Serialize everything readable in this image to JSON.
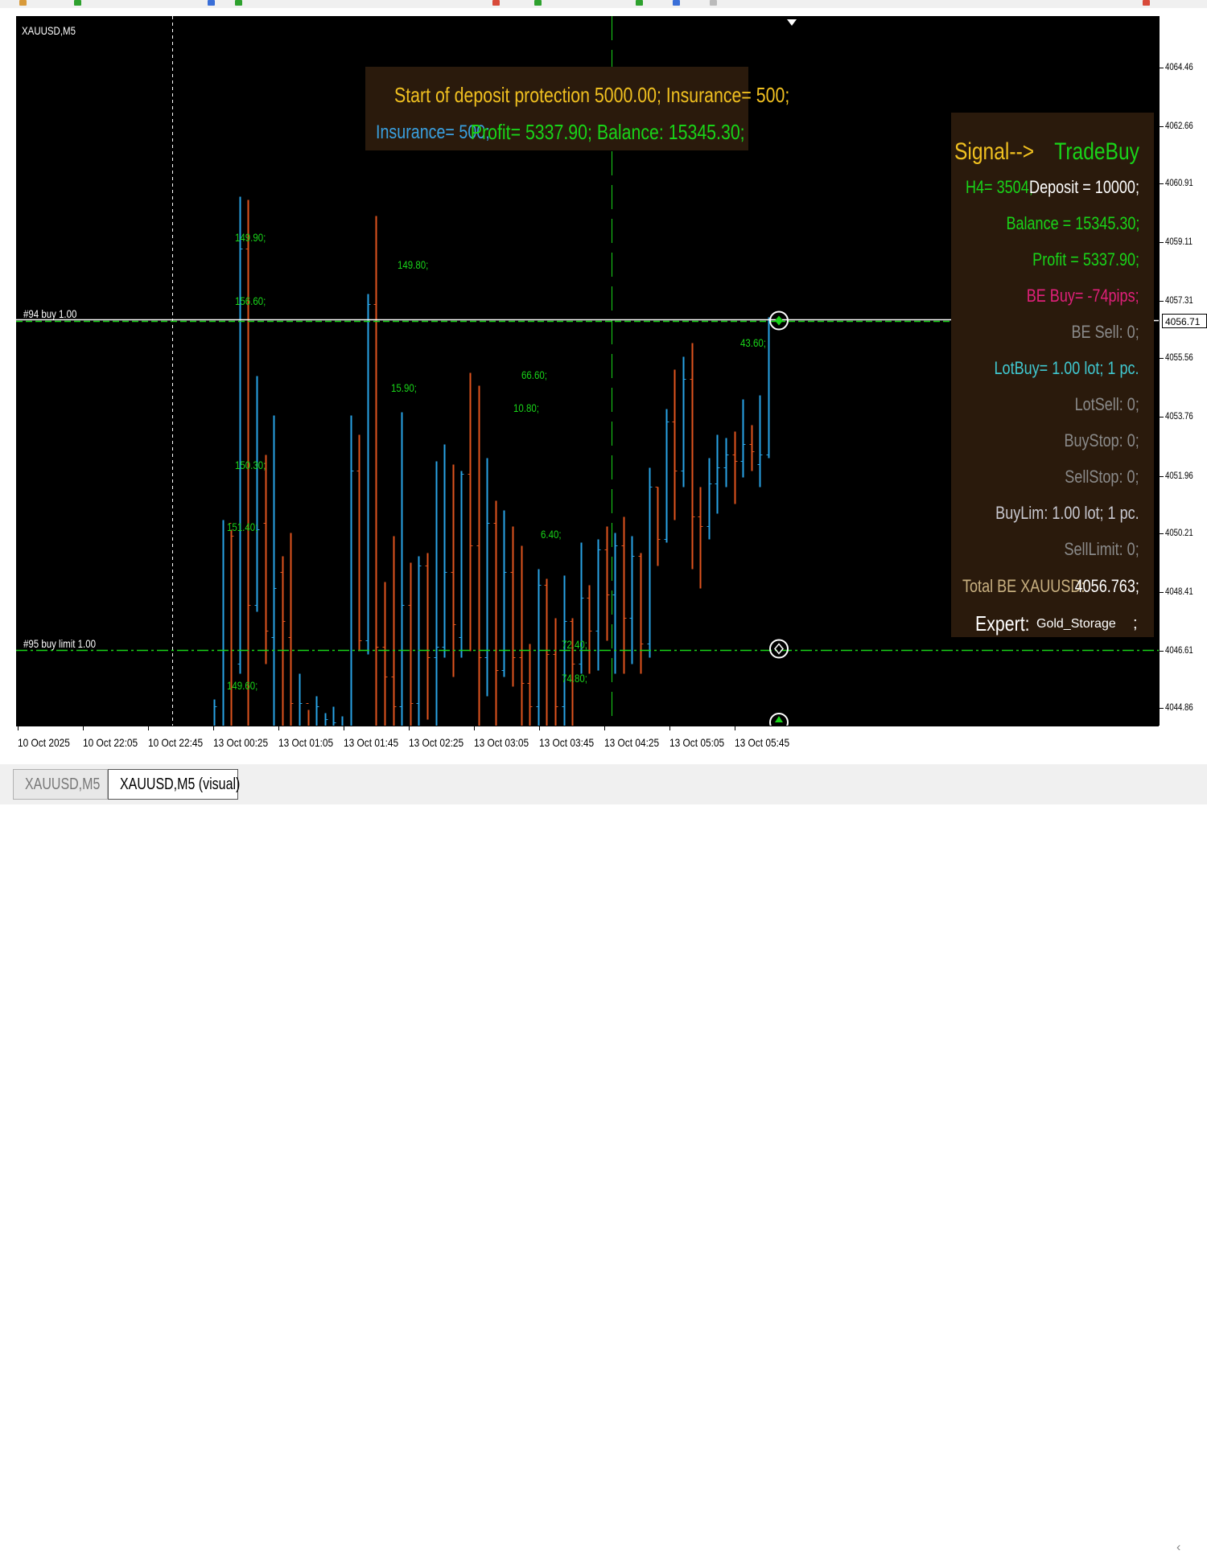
{
  "window": {
    "chart_symbol": "XAUUSD,M5"
  },
  "tabs": [
    {
      "label": "XAUUSD,M5",
      "active": false
    },
    {
      "label": "XAUUSD,M5 (visual)",
      "active": true
    }
  ],
  "colors": {
    "chart_bg": "#000000",
    "bull_candle": "#29a3e6",
    "bear_candle": "#e0541e",
    "green_text": "#19d419",
    "panel_bg": "#2a1a0c",
    "yellow_text": "#f0c020",
    "blue_text": "#3aa0e0",
    "pink_text": "#e0207a",
    "gray_text": "#8a8a8a",
    "cyan_text": "#40c8d0",
    "tan_text": "#c8b080"
  },
  "trades": {
    "buy": "#94 buy 1.00",
    "buy_limit": "#95 buy limit 1.00"
  },
  "top_panel": {
    "line1": "Start of deposit protection 5000.00; Insurance= 500;",
    "insurance": "Insurance= 500;",
    "profit_balance": "Profit= 5337.90; Balance: 15345.30;"
  },
  "right_panel": {
    "signal_label": "Signal-->",
    "signal_value": "TradeBuy",
    "h4": "H4= 3504;",
    "deposit": "Deposit = 10000;",
    "balance": "Balance = 15345.30;",
    "profit": "Profit = 5337.90;",
    "be_buy": "BE Buy= -74pips;",
    "be_sell": "BE Sell: 0;",
    "lot_buy": "LotBuy= 1.00 lot; 1 pc.",
    "lot_sell": "LotSell: 0;",
    "buy_stop": "BuyStop: 0;",
    "sell_stop": "SellStop: 0;",
    "buy_lim": "BuyLim: 1.00 lot; 1 pc.",
    "sell_limit": "SellLimit: 0;",
    "total_be_label": "Total BE XAUUSD:",
    "total_be_value": "4056.763;",
    "expert_label": "Expert:",
    "expert_value": "Gold_Storage",
    "expert_suffix": ";"
  },
  "pl_labels": [
    "149.90;",
    "156.60;",
    "150.30;",
    "151.40;",
    "149.60;",
    "149.80;",
    "15.90;",
    "66.60;",
    "10.80;",
    "6.40;",
    "72.40;",
    "74.80;",
    "43.60;"
  ],
  "price_axis": {
    "labels": [
      "4064.46",
      "4062.66",
      "4060.91",
      "4059.11",
      "4057.31",
      "4055.56",
      "4053.76",
      "4051.96",
      "4050.21",
      "4048.41",
      "4046.61",
      "4044.86"
    ],
    "current": "4056.71"
  },
  "time_axis": {
    "labels": [
      "10 Oct 2025",
      "10 Oct 22:05",
      "10 Oct 22:45",
      "13 Oct 00:25",
      "13 Oct 01:05",
      "13 Oct 01:45",
      "13 Oct 02:25",
      "13 Oct 03:05",
      "13 Oct 03:45",
      "13 Oct 04:25",
      "13 Oct 05:05",
      "13 Oct 05:45"
    ]
  },
  "chart_data": {
    "type": "candlestick",
    "title": "XAUUSD,M5",
    "xlabel": "",
    "ylabel": "",
    "ylim": [
      4044.3,
      4066.0
    ],
    "levels": [
      {
        "name": "#94 buy 1.00",
        "price": 4056.71
      },
      {
        "name": "#95 buy limit 1.00",
        "price": 4046.61
      }
    ],
    "candles": [
      {
        "o": 4044.3,
        "c": 4044.9,
        "h": 4045.1,
        "l": 4044.3
      },
      {
        "o": 4044.3,
        "c": 4044.3,
        "h": 4050.6,
        "l": 4044.3
      },
      {
        "o": 4050.5,
        "c": 4050.1,
        "h": 4050.3,
        "l": 4044.3
      },
      {
        "o": 4046.2,
        "c": 4058.9,
        "h": 4060.5,
        "l": 4045.9
      },
      {
        "o": 4058.9,
        "c": 4048.0,
        "h": 4060.4,
        "l": 4044.3
      },
      {
        "o": 4048.0,
        "c": 4050.3,
        "h": 4055.0,
        "l": 4047.8
      },
      {
        "o": 4050.5,
        "c": 4047.2,
        "h": 4052.6,
        "l": 4046.2
      },
      {
        "o": 4047.0,
        "c": 4048.5,
        "h": 4053.8,
        "l": 4044.3
      },
      {
        "o": 4049.0,
        "c": 4047.5,
        "h": 4049.5,
        "l": 4044.3
      },
      {
        "o": 4047.0,
        "c": 4045.0,
        "h": 4050.2,
        "l": 4044.3
      },
      {
        "o": 4044.3,
        "c": 4045.0,
        "h": 4045.9,
        "l": 4044.3
      },
      {
        "o": 4045.0,
        "c": 4044.3,
        "h": 4044.8,
        "l": 4044.3
      },
      {
        "o": 4044.3,
        "c": 4044.9,
        "h": 4045.2,
        "l": 4044.3
      },
      {
        "o": 4044.3,
        "c": 4044.5,
        "h": 4044.7,
        "l": 4044.3
      },
      {
        "o": 4044.3,
        "c": 4044.4,
        "h": 4044.9,
        "l": 4044.3
      },
      {
        "o": 4044.3,
        "c": 4044.3,
        "h": 4044.6,
        "l": 4044.3
      },
      {
        "o": 4044.3,
        "c": 4052.1,
        "h": 4053.8,
        "l": 4044.3
      },
      {
        "o": 4052.1,
        "c": 4046.9,
        "h": 4053.2,
        "l": 4046.6
      },
      {
        "o": 4046.9,
        "c": 4057.2,
        "h": 4057.5,
        "l": 4046.5
      },
      {
        "o": 4057.2,
        "c": 4046.7,
        "h": 4059.9,
        "l": 4044.3
      },
      {
        "o": 4046.7,
        "c": 4045.8,
        "h": 4048.7,
        "l": 4044.3
      },
      {
        "o": 4045.8,
        "c": 4044.9,
        "h": 4050.1,
        "l": 4044.3
      },
      {
        "o": 4044.9,
        "c": 4048.0,
        "h": 4053.9,
        "l": 4044.3
      },
      {
        "o": 4048.0,
        "c": 4045.0,
        "h": 4049.3,
        "l": 4044.3
      },
      {
        "o": 4045.0,
        "c": 4049.2,
        "h": 4049.5,
        "l": 4044.3
      },
      {
        "o": 4049.2,
        "c": 4046.4,
        "h": 4049.6,
        "l": 4044.5
      },
      {
        "o": 4046.4,
        "c": 4046.7,
        "h": 4052.4,
        "l": 4044.3
      },
      {
        "o": 4046.7,
        "c": 4049.0,
        "h": 4052.9,
        "l": 4046.4
      },
      {
        "o": 4049.0,
        "c": 4047.4,
        "h": 4052.3,
        "l": 4045.8
      },
      {
        "o": 4047.0,
        "c": 4052.0,
        "h": 4052.1,
        "l": 4046.4
      },
      {
        "o": 4052.0,
        "c": 4049.8,
        "h": 4055.1,
        "l": 4046.6
      },
      {
        "o": 4049.8,
        "c": 4046.4,
        "h": 4054.7,
        "l": 4044.3
      },
      {
        "o": 4046.4,
        "c": 4050.5,
        "h": 4052.5,
        "l": 4045.2
      },
      {
        "o": 4050.5,
        "c": 4046.0,
        "h": 4051.2,
        "l": 4044.3
      },
      {
        "o": 4046.0,
        "c": 4049.0,
        "h": 4050.9,
        "l": 4045.8
      },
      {
        "o": 4049.0,
        "c": 4046.4,
        "h": 4050.4,
        "l": 4045.5
      },
      {
        "o": 4046.4,
        "c": 4045.6,
        "h": 4049.8,
        "l": 4044.3
      },
      {
        "o": 4045.6,
        "c": 4044.9,
        "h": 4046.8,
        "l": 4044.3
      },
      {
        "o": 4044.9,
        "c": 4048.6,
        "h": 4049.1,
        "l": 4044.3
      },
      {
        "o": 4048.6,
        "c": 4046.5,
        "h": 4048.8,
        "l": 4044.3
      },
      {
        "o": 4046.5,
        "c": 4044.9,
        "h": 4047.6,
        "l": 4044.3
      },
      {
        "o": 4044.9,
        "c": 4047.5,
        "h": 4048.9,
        "l": 4044.3
      },
      {
        "o": 4047.5,
        "c": 4046.2,
        "h": 4047.6,
        "l": 4044.3
      },
      {
        "o": 4046.2,
        "c": 4048.2,
        "h": 4049.9,
        "l": 4045.9
      },
      {
        "o": 4048.2,
        "c": 4047.2,
        "h": 4048.6,
        "l": 4045.9
      },
      {
        "o": 4047.2,
        "c": 4049.7,
        "h": 4050.0,
        "l": 4046.0
      },
      {
        "o": 4049.7,
        "c": 4048.3,
        "h": 4050.4,
        "l": 4046.9
      },
      {
        "o": 4048.3,
        "c": 4049.8,
        "h": 4050.2,
        "l": 4045.9
      },
      {
        "o": 4049.8,
        "c": 4047.6,
        "h": 4050.7,
        "l": 4045.9
      },
      {
        "o": 4047.6,
        "c": 4049.5,
        "h": 4050.1,
        "l": 4046.2
      },
      {
        "o": 4049.5,
        "c": 4046.8,
        "h": 4049.6,
        "l": 4045.9
      },
      {
        "o": 4046.8,
        "c": 4051.6,
        "h": 4052.2,
        "l": 4046.4
      },
      {
        "o": 4051.6,
        "c": 4050.0,
        "h": 4051.6,
        "l": 4049.2
      },
      {
        "o": 4050.0,
        "c": 4053.6,
        "h": 4054.0,
        "l": 4049.9
      },
      {
        "o": 4053.6,
        "c": 4052.1,
        "h": 4055.2,
        "l": 4050.6
      },
      {
        "o": 4052.1,
        "c": 4054.9,
        "h": 4055.6,
        "l": 4051.6
      },
      {
        "o": 4054.9,
        "c": 4050.7,
        "h": 4056.0,
        "l": 4049.1
      },
      {
        "o": 4050.7,
        "c": 4050.4,
        "h": 4051.6,
        "l": 4048.5
      },
      {
        "o": 4050.4,
        "c": 4051.7,
        "h": 4052.5,
        "l": 4050.0
      },
      {
        "o": 4051.7,
        "c": 4052.2,
        "h": 4053.2,
        "l": 4050.8
      },
      {
        "o": 4052.2,
        "c": 4052.6,
        "h": 4053.1,
        "l": 4051.6
      },
      {
        "o": 4052.6,
        "c": 4052.4,
        "h": 4053.3,
        "l": 4051.1
      },
      {
        "o": 4052.4,
        "c": 4052.9,
        "h": 4054.3,
        "l": 4051.9
      },
      {
        "o": 4052.9,
        "c": 4052.7,
        "h": 4053.5,
        "l": 4052.1
      },
      {
        "o": 4052.3,
        "c": 4052.6,
        "h": 4054.4,
        "l": 4051.6
      },
      {
        "o": 4052.6,
        "c": 4056.7,
        "h": 4056.8,
        "l": 4052.5
      }
    ]
  }
}
